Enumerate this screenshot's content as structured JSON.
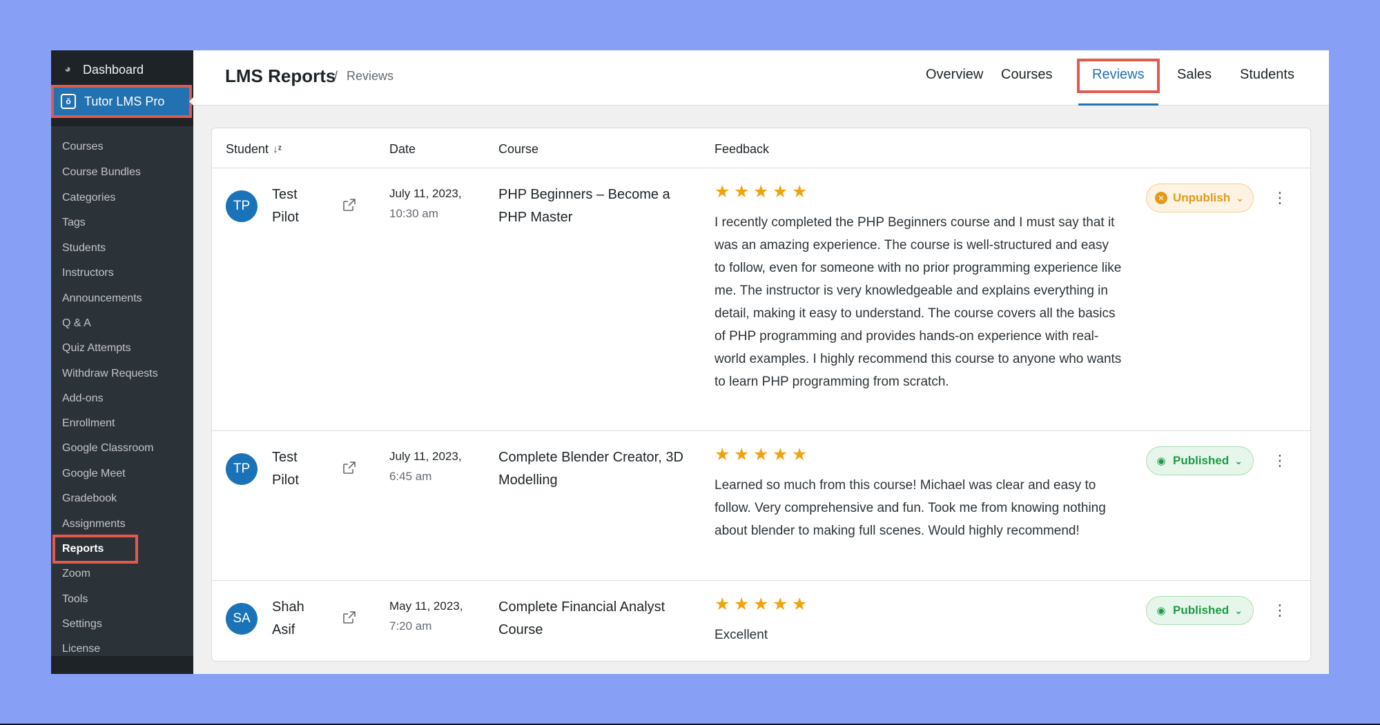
{
  "sidebar": {
    "top_item": {
      "label": "Dashboard",
      "icon": "dashboard-icon"
    },
    "active_item": {
      "label": "Tutor LMS Pro",
      "icon": "tutor-icon"
    },
    "items": [
      {
        "label": "Courses"
      },
      {
        "label": "Course Bundles"
      },
      {
        "label": "Categories"
      },
      {
        "label": "Tags"
      },
      {
        "label": "Students"
      },
      {
        "label": "Instructors"
      },
      {
        "label": "Announcements"
      },
      {
        "label": "Q & A"
      },
      {
        "label": "Quiz Attempts"
      },
      {
        "label": "Withdraw Requests"
      },
      {
        "label": "Add-ons"
      },
      {
        "label": "Enrollment"
      },
      {
        "label": "Google Classroom"
      },
      {
        "label": "Google Meet"
      },
      {
        "label": "Gradebook"
      },
      {
        "label": "Assignments"
      },
      {
        "label": "Reports"
      },
      {
        "label": "Zoom"
      },
      {
        "label": "Tools"
      },
      {
        "label": "Settings"
      },
      {
        "label": "License"
      }
    ],
    "current": "Reports"
  },
  "header": {
    "title": "LMS Reports",
    "separator": "/",
    "breadcrumb": "Reviews",
    "tabs": [
      {
        "label": "Overview"
      },
      {
        "label": "Courses"
      },
      {
        "label": "Reviews"
      },
      {
        "label": "Sales"
      },
      {
        "label": "Students"
      }
    ],
    "active_tab": "Reviews"
  },
  "table": {
    "columns": {
      "student": "Student",
      "date": "Date",
      "course": "Course",
      "feedback": "Feedback"
    },
    "rows": [
      {
        "initials": "TP",
        "first": "Test",
        "last": "Pilot",
        "date": "July 11, 2023,",
        "time": "10:30 am",
        "course": "PHP Beginners – Become a PHP Master",
        "rating": 5,
        "feedback": "I recently completed the PHP Beginners course and I must say that it was an amazing experience. The course is well-structured and easy to follow, even for someone with no prior programming experience like me. The instructor is very knowledgeable and explains everything in detail, making it easy to understand. The course covers all the basics of PHP programming and provides hands-on experience with real-world examples. I highly recommend this course to anyone who wants to learn PHP programming from scratch.",
        "status": "Unpublish"
      },
      {
        "initials": "TP",
        "first": "Test",
        "last": "Pilot",
        "date": "July 11, 2023,",
        "time": "6:45 am",
        "course": "Complete Blender Creator, 3D Modelling",
        "rating": 5,
        "feedback": "Learned so much from this course! Michael was clear and easy to follow. Very comprehensive and fun. Took me from knowing nothing about blender to making full scenes. Would highly recommend!",
        "status": "Published"
      },
      {
        "initials": "SA",
        "first": "Shah",
        "last": "Asif",
        "date": "May 11, 2023,",
        "time": "7:20 am",
        "course": "Complete Financial Analyst Course",
        "rating": 5,
        "feedback": "Excellent",
        "status": "Published"
      }
    ]
  },
  "colors": {
    "background": "#87a0f6",
    "accent": "#2271b1",
    "highlight": "#e05a4e",
    "star": "#f0a30a",
    "published": "#1e9b47",
    "unpublish": "#e29a1b"
  }
}
